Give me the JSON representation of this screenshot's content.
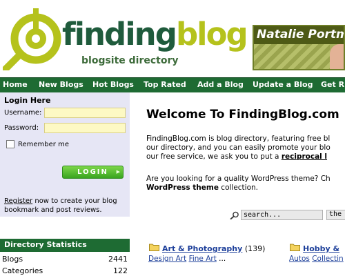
{
  "header": {
    "logo_part1": "finding",
    "logo_part2": "blog",
    "tagline": "blogsite directory"
  },
  "banner": {
    "title": "Natalie Portman"
  },
  "nav": {
    "items": [
      "Home",
      "New Blogs",
      "Hot Blogs",
      "Top Rated",
      "Add a Blog",
      "Update a Blog",
      "Get R"
    ]
  },
  "login": {
    "title": "Login Here",
    "username_label": "Username:",
    "password_label": "Password:",
    "username_value": "",
    "password_value": "",
    "remember_label": "Remember me",
    "button_label": "LOGIN",
    "register_link": "Register",
    "register_text": " now to create your blog bookmark and post reviews."
  },
  "stats": {
    "title": "Directory Statistics",
    "rows": [
      {
        "label": "Blogs",
        "value": "2441"
      },
      {
        "label": "Categories",
        "value": "122"
      }
    ]
  },
  "main": {
    "welcome": "Welcome To FindingBlog.com",
    "para1_line1": "FindingBlog.com is blog directory, featuring free bl",
    "para1_line2": "our directory, and you can easily promote your blo",
    "para1_line3_pre": "our free service, we ask you to put a ",
    "para1_line3_link": "reciprocal l",
    "para2_line1": "Are you looking for a quality WordPress theme? Ch",
    "para2_line2_link": "WordPress theme",
    "para2_line2_post": " collection."
  },
  "search": {
    "value": "search...",
    "select_value": "the"
  },
  "categories": [
    {
      "name": "Art & Photography",
      "count": "(139)",
      "subs": [
        "Design Art",
        "Fine Art"
      ],
      "more": " ..."
    },
    {
      "name": "Hobby & ",
      "count": "",
      "subs": [
        "Autos",
        "Collectin"
      ],
      "more": ""
    }
  ],
  "colors": {
    "nav_green": "#1e6b33",
    "logo_dark_green": "#1f5b3c",
    "logo_lime": "#b5c21c",
    "login_bg": "#e6e6f5",
    "link_blue": "#1d3f9a"
  }
}
